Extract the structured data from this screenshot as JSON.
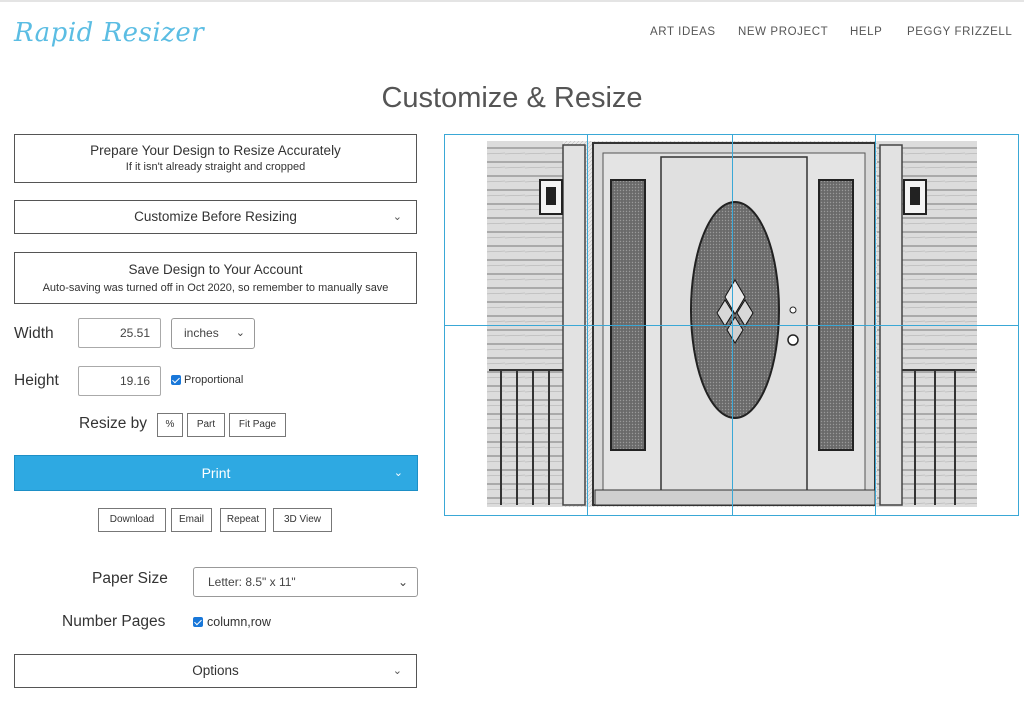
{
  "header": {
    "logo": "Rapid Resizer",
    "nav": [
      "ART IDEAS",
      "NEW PROJECT",
      "HELP",
      "PEGGY FRIZZELL"
    ]
  },
  "page_title": "Customize & Resize",
  "prepare": {
    "title": "Prepare Your Design to Resize Accurately",
    "subtitle": "If it isn't already straight and cropped"
  },
  "customize": {
    "label": "Customize Before Resizing"
  },
  "save": {
    "title": "Save Design to Your Account",
    "subtitle": "Auto-saving was turned off in Oct 2020, so remember to manually save"
  },
  "width": {
    "label": "Width",
    "value": "25.51",
    "unit": "inches"
  },
  "height": {
    "label": "Height",
    "value": "19.16",
    "proportional_label": "Proportional",
    "proportional": true
  },
  "resize_by": {
    "label": "Resize by",
    "buttons": [
      "%",
      "Part",
      "Fit Page"
    ]
  },
  "print": {
    "label": "Print"
  },
  "actions": [
    "Download",
    "Email",
    "Repeat",
    "3D View"
  ],
  "paper": {
    "label": "Paper Size",
    "value": "Letter: 8.5\" x 11\""
  },
  "number_pages": {
    "label": "Number Pages",
    "checkbox_label": "column,row",
    "checked": true
  },
  "options": {
    "label": "Options"
  },
  "colors": {
    "accent": "#2ea9e2",
    "grid": "#3aa8d6",
    "logo": "#5bbde3"
  }
}
